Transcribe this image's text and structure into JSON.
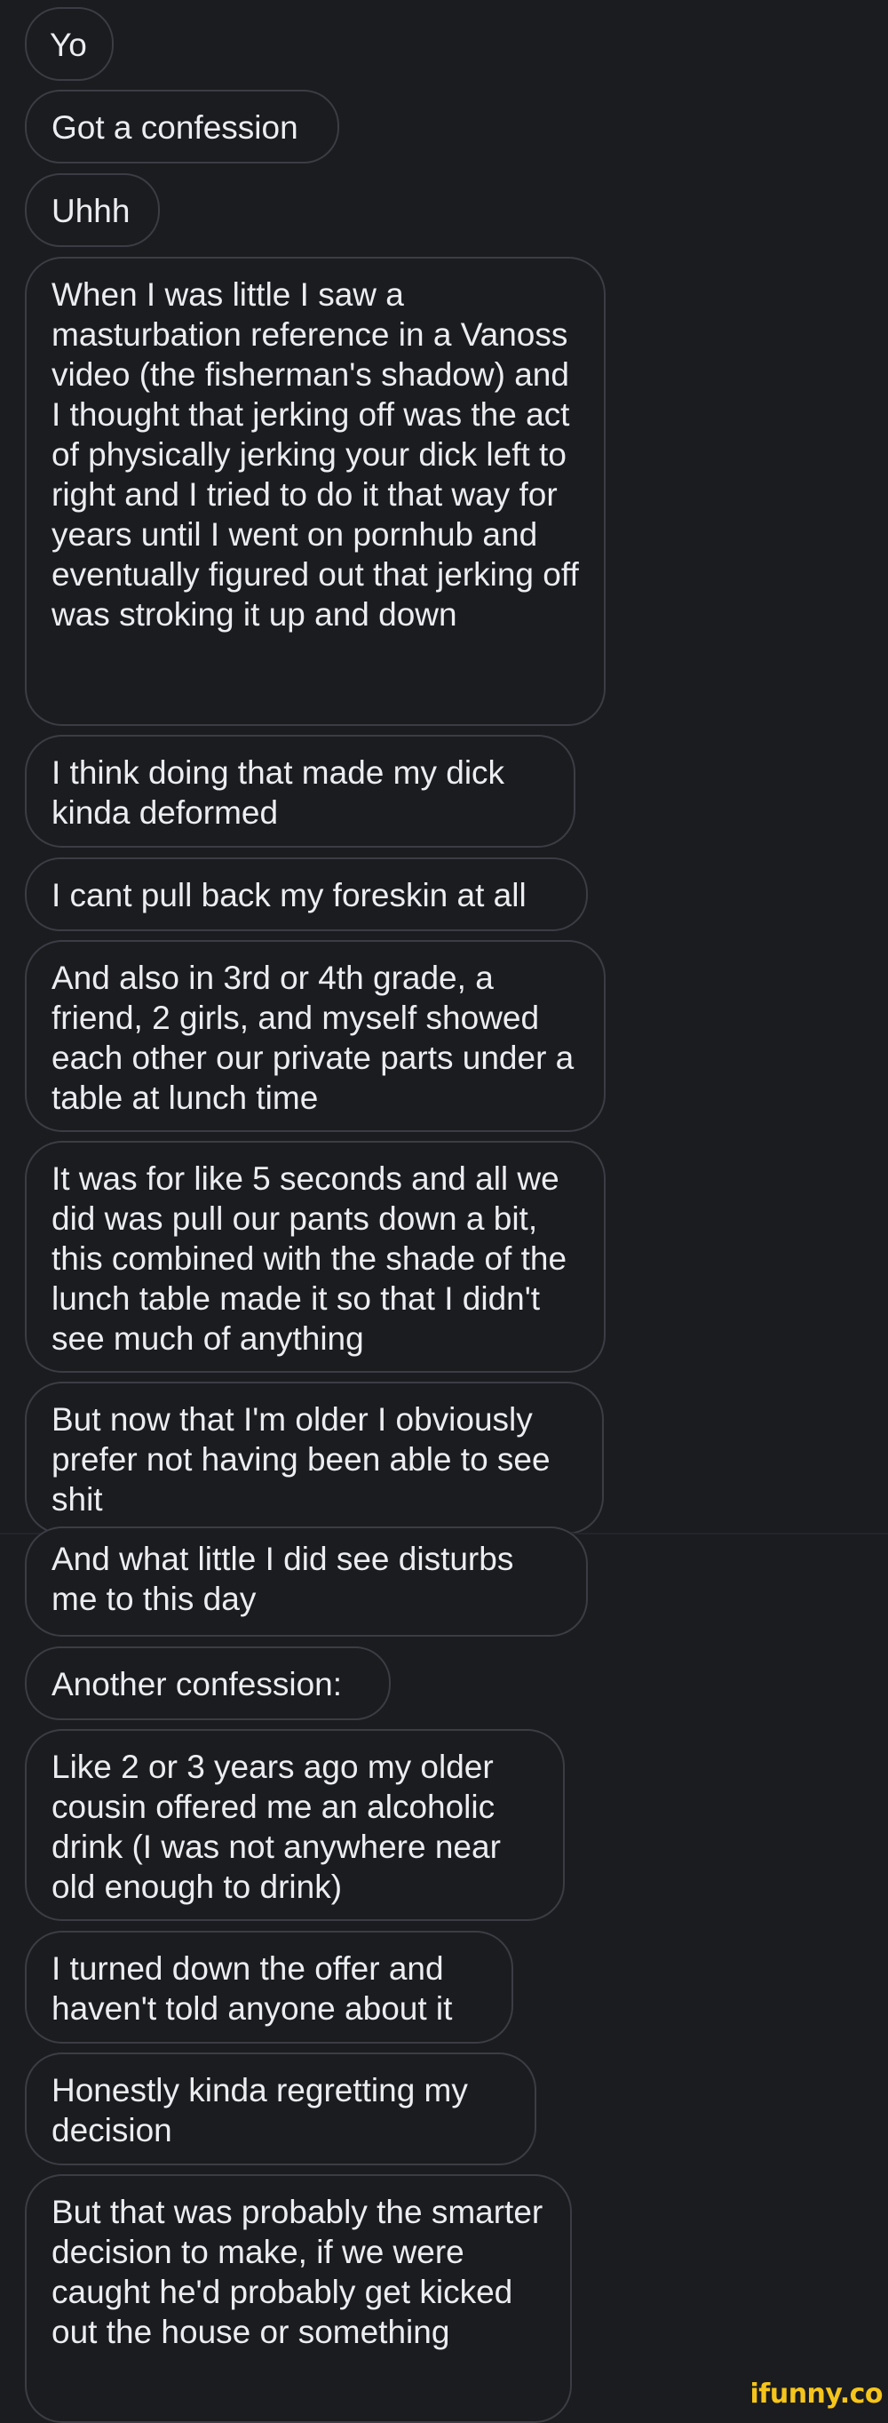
{
  "messages": [
    {
      "text": "Yo"
    },
    {
      "text": "Got a confession"
    },
    {
      "text": "Uhhh"
    },
    {
      "text": "When I was little I saw a masturbation reference in a Vanoss video (the fisherman's shadow) and I thought that jerking off was the act of physically jerking your dick left to right and I tried to do it that way for years until I went on pornhub and eventually figured out that jerking off was stroking it up and down"
    },
    {
      "text": "I think doing that made my dick kinda deformed"
    },
    {
      "text": "I cant pull back my foreskin at all"
    },
    {
      "text": "And also in 3rd or 4th grade, a friend, 2 girls, and myself showed each other our private parts under a table at lunch time"
    },
    {
      "text": "It was for like 5 seconds and all we did was pull our pants down a bit, this combined with the shade of the lunch table made it so that I didn't see much of anything"
    },
    {
      "text": "But now that I'm older I obviously prefer not having been able to see shit"
    },
    {
      "text": "And what little I did see disturbs me to this day"
    },
    {
      "text": "Another confession:"
    },
    {
      "text": "Like 2 or 3 years ago my older cousin offered me an alcoholic drink (I was not anywhere near old enough to drink)"
    },
    {
      "text": "I turned down the offer and haven't told anyone about it"
    },
    {
      "text": "Honestly kinda regretting my decision"
    },
    {
      "text": "But that was probably the smarter decision to make, if we were caught he'd probably get kicked out the house or something"
    }
  ],
  "watermark": "ifunny.co",
  "colors": {
    "background": "#1b1c20",
    "bubble_border": "#3c3d44",
    "text": "#ecedf0",
    "watermark": "#f5c51b"
  }
}
